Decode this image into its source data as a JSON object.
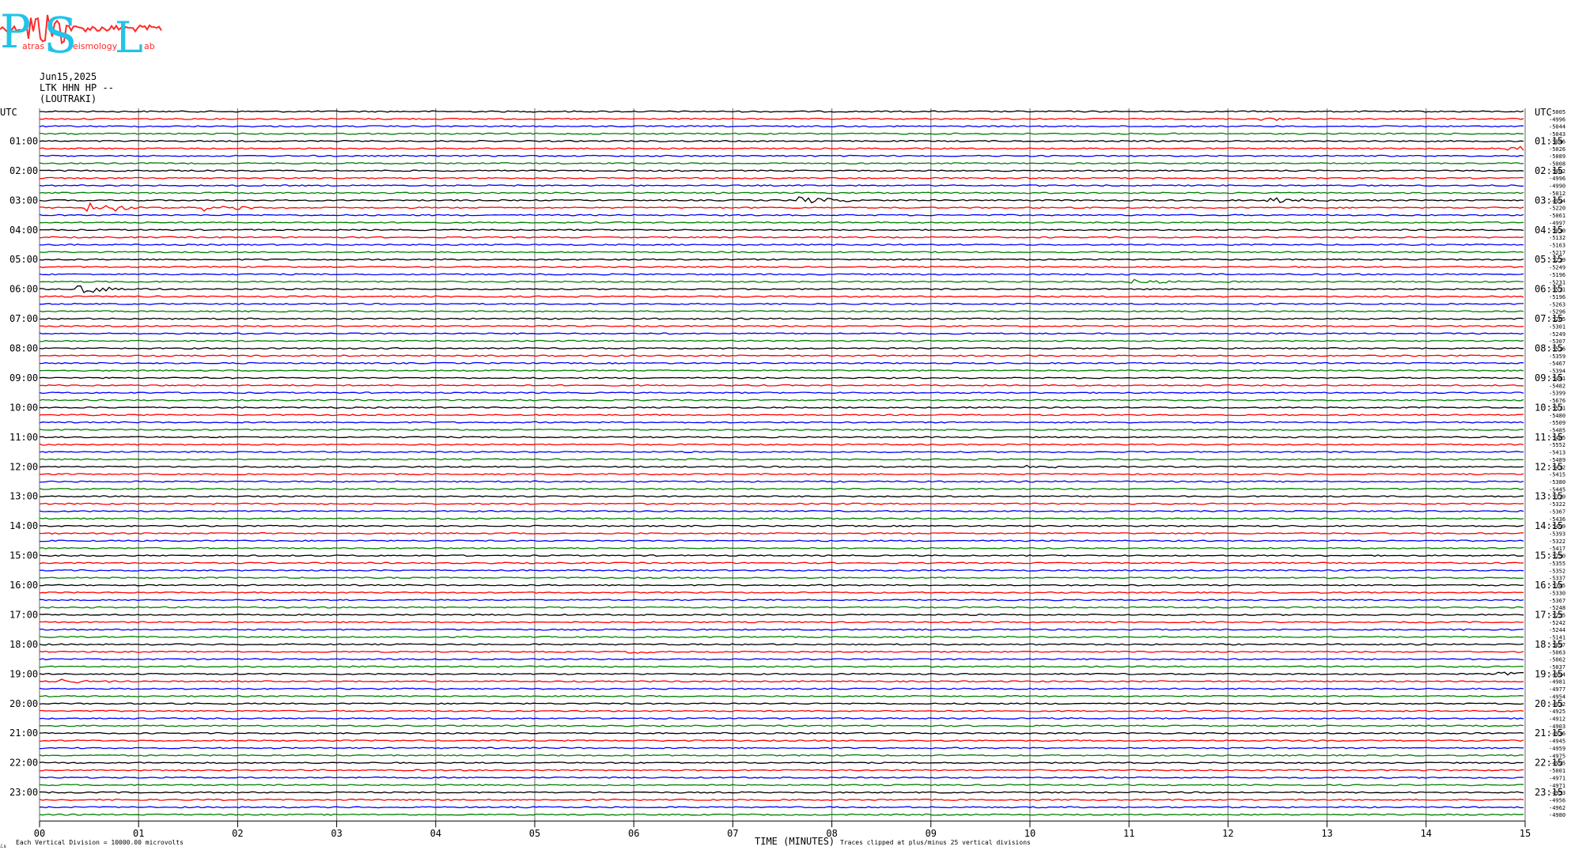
{
  "header": {
    "logo": {
      "big_letters": [
        "P",
        "S",
        "L"
      ],
      "small_words": [
        "atras",
        "eismology",
        "ab"
      ]
    },
    "date": "Jun15,2025",
    "channel": "LTK HHN HP --",
    "station": "(LOUTRAKI)"
  },
  "footer": {
    "scale_note": "Each Vertical Division = 10000.00 microvolts",
    "clip_note": "Traces clipped at plus/minus 25 vertical divisions",
    "corner_mark": "ℒs"
  },
  "chart_data": {
    "type": "line",
    "title": "",
    "xlabel": "TIME (MINUTES)",
    "x_ticks": [
      "00",
      "01",
      "02",
      "03",
      "04",
      "05",
      "06",
      "07",
      "08",
      "09",
      "10",
      "11",
      "12",
      "13",
      "14",
      "15"
    ],
    "xlim": [
      0,
      15
    ],
    "left_axis_title": "UTC",
    "right_axis_title": "UTC",
    "left_hour_labels": [
      "01:00",
      "02:00",
      "03:00",
      "04:00",
      "05:00",
      "06:00",
      "07:00",
      "08:00",
      "09:00",
      "10:00",
      "11:00",
      "12:00",
      "13:00",
      "14:00",
      "15:00",
      "16:00",
      "17:00",
      "18:00",
      "19:00",
      "20:00",
      "21:00",
      "22:00",
      "23:00"
    ],
    "right_hour_labels": [
      "01:15",
      "02:15",
      "03:15",
      "04:15",
      "05:15",
      "06:15",
      "07:15",
      "08:15",
      "09:15",
      "10:15",
      "11:15",
      "12:15",
      "13:15",
      "14:15",
      "15:15",
      "16:15",
      "17:15",
      "18:15",
      "19:15",
      "20:15",
      "21:15",
      "22:15",
      "23:15"
    ],
    "trace_colors": [
      "#000000",
      "#ff0000",
      "#0000ff",
      "#008000"
    ],
    "grid": true,
    "trace_offsets": [
      "-5005",
      "-4996",
      "-5044",
      "-5043",
      "-5046",
      "-5026",
      "-5089",
      "-5008",
      "-5002",
      "-4996",
      "-4990",
      "-5012",
      "-4994",
      "-5220",
      "-5061",
      "-4997",
      "-5030",
      "-5132",
      "-5163",
      "-5217",
      "-5219",
      "-5249",
      "-5196",
      "-5231",
      "-5571",
      "-5196",
      "-5263",
      "-5296",
      "-5265",
      "-5301",
      "-5249",
      "-5307",
      "-5516",
      "-5359",
      "-5467",
      "-5394",
      "-5441",
      "-5482",
      "-5399",
      "-5676",
      "-5571",
      "-5480",
      "-5509",
      "-5485",
      "-5485",
      "-5552",
      "-5413",
      "-5489",
      "-5432",
      "-5415",
      "-5380",
      "-5445",
      "-5379",
      "-5322",
      "-5367",
      "-5436",
      "-5499",
      "-5393",
      "-5322",
      "-5417",
      "-5250",
      "-5355",
      "-5352",
      "-5337",
      "-5345",
      "-5330",
      "-5367",
      "-5248",
      "-5255",
      "-5242",
      "-5244",
      "-5141",
      "-5097",
      "-5063",
      "-5062",
      "-5037",
      "-4994",
      "-4981",
      "-4977",
      "-4954",
      "-4932",
      "-4925",
      "-4912",
      "-4903",
      "-4936",
      "-4945",
      "-4959",
      "-4975",
      "-4995",
      "-5001",
      "-4971",
      "-4971",
      "-4953",
      "-4956",
      "-4962",
      "-4980"
    ],
    "events": [
      {
        "trace": 1,
        "x": 12.35,
        "amplitude": 0.3
      },
      {
        "trace": 5,
        "x": 14.85,
        "amplitude": 0.6
      },
      {
        "trace": 12,
        "x": 7.7,
        "amplitude": 0.7
      },
      {
        "trace": 12,
        "x": 12.4,
        "amplitude": 0.7
      },
      {
        "trace": 13,
        "x": 0.5,
        "amplitude": 1.3
      },
      {
        "trace": 13,
        "x": 1.7,
        "amplitude": 0.8
      },
      {
        "trace": 23,
        "x": 11.05,
        "amplitude": 0.7
      },
      {
        "trace": 24,
        "x": 0.42,
        "amplitude": 0.9
      },
      {
        "trace": 48,
        "x": 10.0,
        "amplitude": 0.4
      },
      {
        "trace": 73,
        "x": 5.9,
        "amplitude": 0.3
      },
      {
        "trace": 76,
        "x": 14.7,
        "amplitude": 0.5
      },
      {
        "trace": 77,
        "x": 0.25,
        "amplitude": 0.4
      }
    ]
  }
}
